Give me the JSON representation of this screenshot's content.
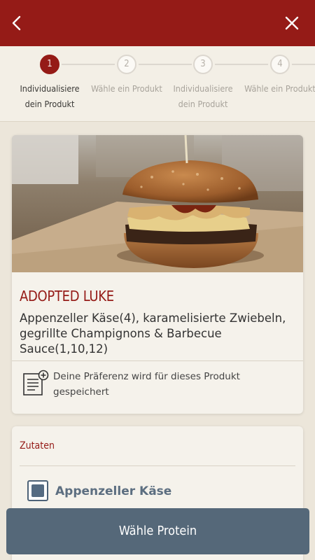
{
  "header": {
    "back_icon": "chevron-left-icon",
    "close_icon": "close-icon"
  },
  "steps": [
    {
      "number": "1",
      "label": "Individualisiere dein Produkt",
      "active": true
    },
    {
      "number": "2",
      "label": "Wähle ein Produkt",
      "active": false
    },
    {
      "number": "3",
      "label": "Individualisiere dein Produkt",
      "active": false
    },
    {
      "number": "4",
      "label": "Wähle ein Produkt",
      "active": false
    }
  ],
  "product": {
    "name": "ADOPTED LUKE",
    "description": "Appenzeller Käse(4), karamelisierte Zwiebeln, gegrillte Champignons & Barbecue Sauce(1,10,12)",
    "preference_icon": "document-plus-icon",
    "preference_note": "Deine Präferenz wird für dieses Produkt gespeichert"
  },
  "ingredients": {
    "title": "Zutaten",
    "items": [
      {
        "label": "Appenzeller Käse",
        "checked": true
      }
    ]
  },
  "cta": {
    "label": "Wähle Protein"
  },
  "colors": {
    "brand_red": "#951b17",
    "button_slate": "#556879",
    "background": "#ece6da"
  }
}
